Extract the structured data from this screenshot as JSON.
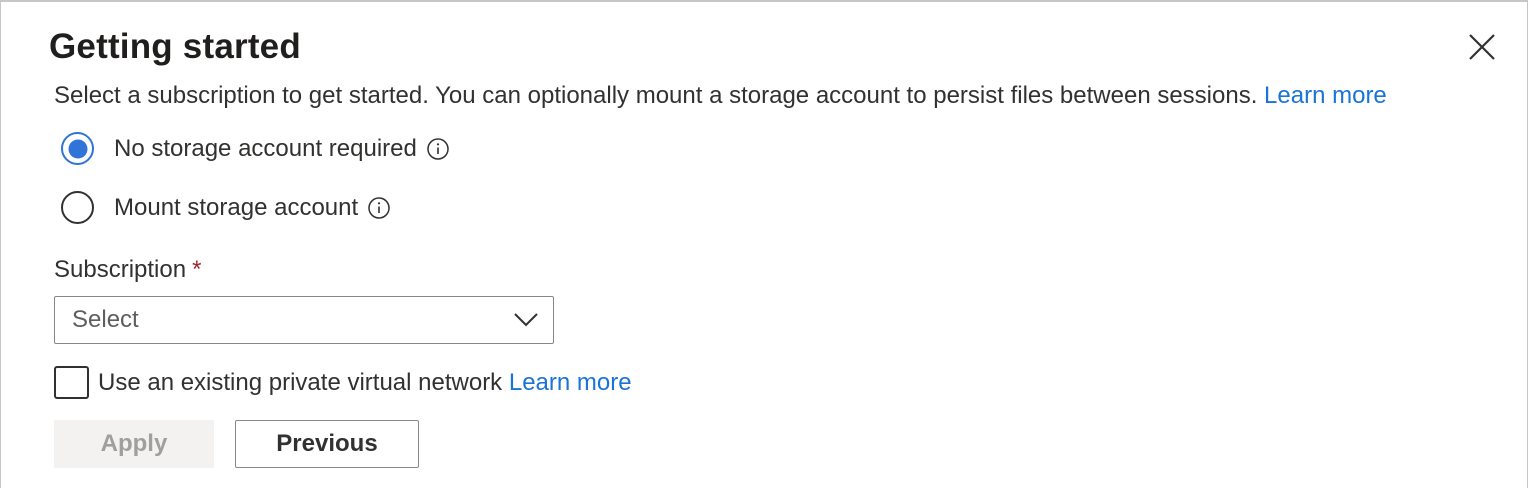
{
  "dialog": {
    "title": "Getting started",
    "description": "Select a subscription to get started. You can optionally mount a storage account to persist files between sessions.",
    "description_link": "Learn more"
  },
  "storage_options": [
    {
      "label": "No storage account required",
      "checked": true
    },
    {
      "label": "Mount storage account",
      "checked": false
    }
  ],
  "subscription": {
    "label": "Subscription",
    "required_marker": "*",
    "value": "Select"
  },
  "vnet": {
    "label": "Use an existing private virtual network",
    "link": "Learn more",
    "checked": false
  },
  "buttons": {
    "apply": "Apply",
    "previous": "Previous"
  },
  "colors": {
    "accent": "#2f74d6",
    "link": "#1a73d9",
    "required": "#a4262c",
    "disabled_bg": "#f3f2f1",
    "disabled_text": "#a19f9d"
  },
  "icons": {
    "close": "close-icon",
    "info": "info-icon",
    "dropdown": "chevron-down-icon"
  }
}
